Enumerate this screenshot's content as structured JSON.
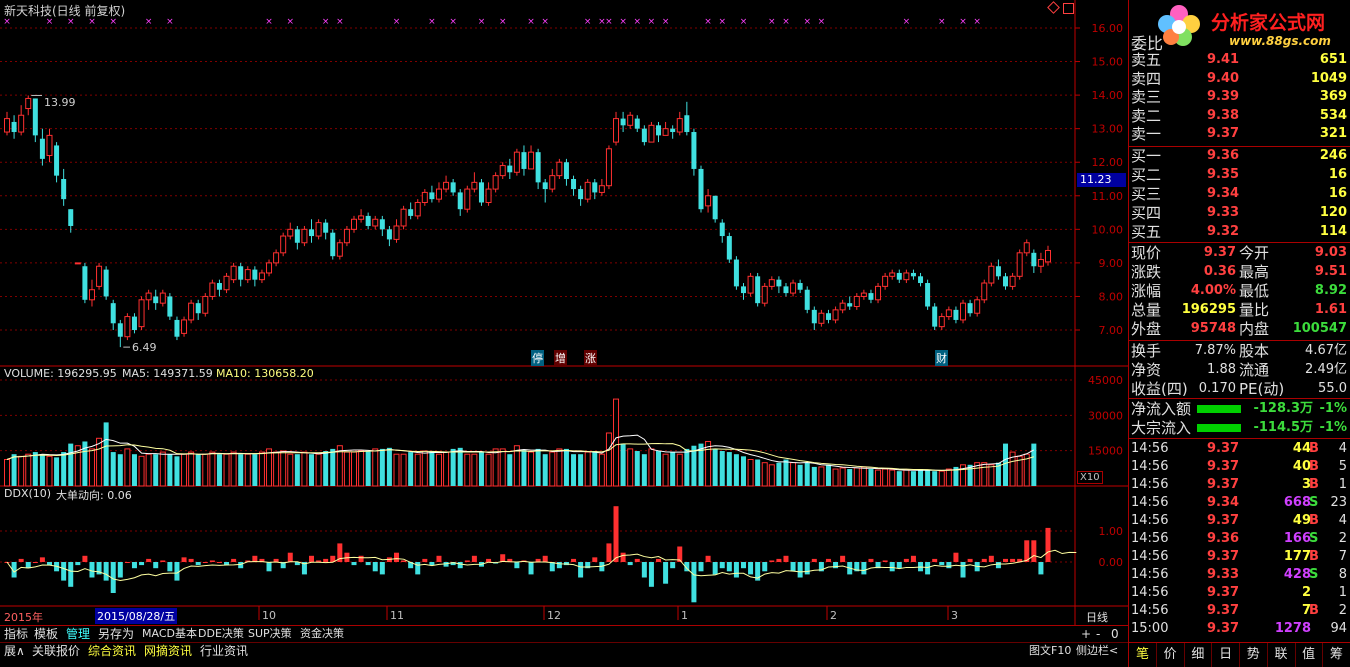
{
  "title": "新天科技(日线 前复权)",
  "price_axis": [
    "16.00",
    "15.00",
    "14.00",
    "13.00",
    "12.00",
    "11.00",
    "10.00",
    "9.00",
    "8.00",
    "7.00"
  ],
  "price_marker": "11.23",
  "high_label": "13.99",
  "low_label": "6.49",
  "event_tags": [
    "停",
    "增",
    "涨",
    "财"
  ],
  "volume_info": {
    "label": "VOLUME: 196295.95",
    "ma5": "MA5: 149371.59",
    "ma10": "MA10: 130658.20"
  },
  "volume_axis": [
    "45000",
    "30000",
    "15000"
  ],
  "volume_unit": "X10",
  "ddx_info": {
    "label": "DDX(10)",
    "big": "大单动向: 0.06"
  },
  "ddx_axis": [
    "1.00",
    "0.00"
  ],
  "date_axis": {
    "year": "2015年",
    "cursor": "2015/08/28/五",
    "m10": "10",
    "m11": "11",
    "m12": "12",
    "m1": "1",
    "m2": "2",
    "m3": "3",
    "period": "日线"
  },
  "bottom_tabs": [
    "指标",
    "模板",
    "管理",
    "另存为",
    "MACD基本",
    "DDE决策",
    "SUP决策",
    "资金决策"
  ],
  "bottom_tabs2": [
    "展∧",
    "关联报价",
    "综合资讯",
    "网摘资讯",
    "行业资讯"
  ],
  "bottom_right": {
    "plus": "+",
    "minus": "-",
    "zero": "0",
    "f10": "图文F10",
    "sidebar": "侧边栏<"
  },
  "logo": {
    "name": "分析家公式网",
    "url": "www.88gs.com"
  },
  "orderbook_header": "委比",
  "asks": [
    {
      "label": "卖五",
      "price": "9.41",
      "vol": "651"
    },
    {
      "label": "卖四",
      "price": "9.40",
      "vol": "1049"
    },
    {
      "label": "卖三",
      "price": "9.39",
      "vol": "369"
    },
    {
      "label": "卖二",
      "price": "9.38",
      "vol": "534"
    },
    {
      "label": "卖一",
      "price": "9.37",
      "vol": "321"
    }
  ],
  "bids": [
    {
      "label": "买一",
      "price": "9.36",
      "vol": "246"
    },
    {
      "label": "买二",
      "price": "9.35",
      "vol": "16"
    },
    {
      "label": "买三",
      "price": "9.34",
      "vol": "16"
    },
    {
      "label": "买四",
      "price": "9.33",
      "vol": "120"
    },
    {
      "label": "买五",
      "price": "9.32",
      "vol": "114"
    }
  ],
  "quote": [
    {
      "l1": "现价",
      "v1": "9.37",
      "l2": "今开",
      "v2": "9.03",
      "c1": "#ff4040",
      "c2": "#ff4040"
    },
    {
      "l1": "涨跌",
      "v1": "0.36",
      "l2": "最高",
      "v2": "9.51",
      "c1": "#ff4040",
      "c2": "#ff4040"
    },
    {
      "l1": "涨幅",
      "v1": "4.00%",
      "l2": "最低",
      "v2": "8.92",
      "c1": "#ff4040",
      "c2": "#3cdc3c"
    },
    {
      "l1": "总量",
      "v1": "196295",
      "l2": "量比",
      "v2": "1.61",
      "c1": "#ffff40",
      "c2": "#ff4040"
    },
    {
      "l1": "外盘",
      "v1": "95748",
      "l2": "内盘",
      "v2": "100547",
      "c1": "#ff4040",
      "c2": "#3cdc3c"
    }
  ],
  "fund": [
    {
      "l1": "换手",
      "v1": "7.87%",
      "l2": "股本",
      "v2": "4.67亿"
    },
    {
      "l1": "净资",
      "v1": "1.88",
      "l2": "流通",
      "v2": "2.49亿"
    },
    {
      "l1": "收益(四)",
      "v1": "0.170",
      "l2": "PE(动)",
      "v2": "55.0"
    }
  ],
  "flows": [
    {
      "label": "净流入额",
      "value": "-128.3万",
      "pct": "-1%"
    },
    {
      "label": "大宗流入",
      "value": "-114.5万",
      "pct": "-1%"
    }
  ],
  "ticks": [
    {
      "t": "14:56",
      "p": "9.37",
      "v": "44",
      "d": "B",
      "n": "4"
    },
    {
      "t": "14:56",
      "p": "9.37",
      "v": "40",
      "d": "B",
      "n": "5"
    },
    {
      "t": "14:56",
      "p": "9.37",
      "v": "3",
      "d": "B",
      "n": "1"
    },
    {
      "t": "14:56",
      "p": "9.34",
      "v": "668",
      "d": "S",
      "n": "23"
    },
    {
      "t": "14:56",
      "p": "9.37",
      "v": "49",
      "d": "B",
      "n": "4"
    },
    {
      "t": "14:56",
      "p": "9.36",
      "v": "166",
      "d": "S",
      "n": "2"
    },
    {
      "t": "14:56",
      "p": "9.37",
      "v": "177",
      "d": "B",
      "n": "7"
    },
    {
      "t": "14:56",
      "p": "9.33",
      "v": "428",
      "d": "S",
      "n": "8"
    },
    {
      "t": "14:56",
      "p": "9.37",
      "v": "2",
      "d": "",
      "n": "1"
    },
    {
      "t": "14:56",
      "p": "9.37",
      "v": "7",
      "d": "B",
      "n": "2"
    },
    {
      "t": "15:00",
      "p": "9.37",
      "v": "1278",
      "d": "",
      "n": "94"
    }
  ],
  "panel_tabs": [
    "笔",
    "价",
    "细",
    "日",
    "势",
    "联",
    "值",
    "筹"
  ],
  "colors": {
    "up": "#ff3030",
    "down": "#40e0e0",
    "grid": "#800000",
    "axis": "#c00000",
    "ma": "#ffffa0",
    "magenta": "#ff40ff",
    "bg": "#000000"
  },
  "chart_data": {
    "type": "candlestick",
    "candles": [
      [
        12.9,
        13.3,
        13.5,
        12.8
      ],
      [
        13.2,
        12.9,
        13.4,
        12.7
      ],
      [
        12.9,
        13.4,
        13.7,
        12.8
      ],
      [
        13.6,
        13.9,
        13.99,
        13.4
      ],
      [
        13.9,
        12.8,
        13.9,
        12.6
      ],
      [
        12.7,
        12.1,
        13.0,
        11.9
      ],
      [
        12.2,
        12.8,
        13.0,
        12.0
      ],
      [
        12.5,
        11.6,
        12.6,
        11.4
      ],
      [
        11.5,
        10.9,
        11.8,
        10.7
      ],
      [
        10.6,
        10.1,
        10.6,
        9.9
      ],
      [
        9.0,
        9.0,
        9.0,
        9.0
      ],
      [
        8.9,
        7.9,
        9.0,
        7.8
      ],
      [
        7.9,
        8.2,
        8.5,
        7.7
      ],
      [
        8.3,
        8.9,
        9.0,
        8.2
      ],
      [
        8.8,
        8.0,
        8.9,
        7.9
      ],
      [
        7.8,
        7.2,
        7.9,
        7.0
      ],
      [
        7.2,
        6.8,
        7.3,
        6.49
      ],
      [
        6.8,
        7.4,
        7.5,
        6.7
      ],
      [
        7.4,
        7.0,
        7.5,
        6.9
      ],
      [
        7.1,
        7.9,
        8.0,
        7.0
      ],
      [
        7.9,
        8.1,
        8.2,
        7.6
      ],
      [
        8.0,
        7.8,
        8.2,
        7.6
      ],
      [
        7.8,
        8.1,
        8.2,
        7.7
      ],
      [
        8.0,
        7.4,
        8.1,
        7.3
      ],
      [
        7.3,
        6.8,
        7.4,
        6.7
      ],
      [
        6.9,
        7.3,
        7.4,
        6.8
      ],
      [
        7.3,
        7.8,
        7.9,
        7.2
      ],
      [
        7.8,
        7.5,
        7.9,
        7.3
      ],
      [
        7.5,
        8.0,
        8.1,
        7.4
      ],
      [
        8.0,
        8.4,
        8.5,
        7.9
      ],
      [
        8.4,
        8.2,
        8.5,
        8.0
      ],
      [
        8.2,
        8.6,
        8.7,
        8.1
      ],
      [
        8.5,
        8.9,
        9.0,
        8.4
      ],
      [
        8.9,
        8.5,
        9.0,
        8.3
      ],
      [
        8.5,
        8.8,
        8.9,
        8.4
      ],
      [
        8.8,
        8.5,
        8.9,
        8.3
      ],
      [
        8.5,
        8.7,
        8.8,
        8.4
      ],
      [
        8.7,
        9.0,
        9.1,
        8.6
      ],
      [
        9.0,
        9.3,
        9.4,
        8.9
      ],
      [
        9.3,
        9.8,
        9.9,
        9.2
      ],
      [
        9.8,
        10.0,
        10.2,
        9.7
      ],
      [
        10.0,
        9.6,
        10.1,
        9.4
      ],
      [
        9.6,
        10.0,
        10.1,
        9.5
      ],
      [
        10.0,
        9.8,
        10.3,
        9.6
      ],
      [
        9.8,
        10.2,
        10.3,
        9.7
      ],
      [
        10.2,
        9.9,
        10.3,
        9.7
      ],
      [
        9.9,
        9.2,
        10.0,
        9.1
      ],
      [
        9.2,
        9.6,
        9.7,
        9.1
      ],
      [
        9.6,
        10.0,
        10.1,
        9.5
      ],
      [
        10.0,
        10.3,
        10.4,
        9.9
      ],
      [
        10.3,
        10.4,
        10.6,
        10.2
      ],
      [
        10.4,
        10.1,
        10.5,
        10.0
      ],
      [
        10.1,
        10.3,
        10.4,
        10.0
      ],
      [
        10.3,
        10.0,
        10.4,
        9.8
      ],
      [
        10.0,
        9.7,
        10.1,
        9.5
      ],
      [
        9.7,
        10.1,
        10.3,
        9.6
      ],
      [
        10.1,
        10.6,
        10.7,
        10.0
      ],
      [
        10.6,
        10.4,
        10.8,
        10.3
      ],
      [
        10.4,
        10.8,
        10.9,
        10.3
      ],
      [
        10.8,
        11.1,
        11.2,
        10.7
      ],
      [
        11.1,
        10.9,
        11.3,
        10.8
      ],
      [
        10.9,
        11.2,
        11.4,
        10.8
      ],
      [
        11.2,
        11.4,
        11.6,
        11.1
      ],
      [
        11.4,
        11.1,
        11.5,
        11.0
      ],
      [
        11.1,
        10.6,
        11.2,
        10.4
      ],
      [
        10.6,
        11.2,
        11.3,
        10.5
      ],
      [
        11.2,
        11.4,
        11.7,
        11.1
      ],
      [
        11.4,
        10.8,
        11.5,
        10.7
      ],
      [
        10.8,
        11.2,
        11.4,
        10.7
      ],
      [
        11.2,
        11.6,
        11.7,
        11.1
      ],
      [
        11.6,
        11.9,
        12.0,
        11.5
      ],
      [
        11.9,
        11.7,
        12.1,
        11.5
      ],
      [
        11.7,
        12.3,
        12.4,
        11.6
      ],
      [
        12.3,
        11.8,
        12.5,
        11.6
      ],
      [
        11.8,
        12.3,
        12.5,
        11.8
      ],
      [
        12.3,
        11.4,
        12.4,
        11.2
      ],
      [
        11.4,
        11.2,
        11.5,
        10.8
      ],
      [
        11.2,
        11.6,
        11.8,
        11.1
      ],
      [
        11.6,
        12.0,
        12.1,
        11.5
      ],
      [
        12.0,
        11.5,
        12.1,
        11.3
      ],
      [
        11.5,
        11.2,
        11.6,
        11.0
      ],
      [
        11.2,
        10.9,
        11.3,
        10.7
      ],
      [
        10.9,
        11.4,
        11.5,
        10.8
      ],
      [
        11.4,
        11.1,
        11.5,
        10.9
      ],
      [
        11.1,
        11.3,
        11.5,
        11.0
      ],
      [
        11.3,
        12.4,
        12.5,
        11.2
      ],
      [
        12.6,
        13.3,
        13.5,
        12.5
      ],
      [
        13.3,
        13.1,
        13.5,
        12.9
      ],
      [
        13.1,
        13.4,
        13.5,
        13.0
      ],
      [
        13.3,
        13.0,
        13.4,
        12.9
      ],
      [
        13.0,
        12.6,
        13.1,
        12.5
      ],
      [
        12.6,
        13.1,
        13.2,
        12.6
      ],
      [
        13.1,
        12.8,
        13.2,
        12.6
      ],
      [
        12.8,
        13.0,
        13.2,
        12.8
      ],
      [
        13.0,
        12.9,
        13.1,
        12.7
      ],
      [
        12.9,
        13.3,
        13.5,
        12.8
      ],
      [
        13.4,
        12.9,
        13.8,
        12.8
      ],
      [
        12.9,
        11.8,
        13.0,
        11.6
      ],
      [
        11.8,
        10.6,
        11.9,
        10.5
      ],
      [
        10.7,
        11.0,
        11.2,
        10.5
      ],
      [
        11.0,
        10.3,
        11.0,
        10.2
      ],
      [
        10.2,
        9.8,
        10.3,
        9.6
      ],
      [
        9.8,
        9.1,
        9.9,
        9.0
      ],
      [
        9.1,
        8.3,
        9.2,
        8.2
      ],
      [
        8.3,
        8.1,
        8.4,
        7.9
      ],
      [
        8.1,
        8.6,
        8.7,
        8.0
      ],
      [
        8.6,
        7.8,
        8.7,
        7.7
      ],
      [
        7.8,
        8.3,
        8.4,
        7.7
      ],
      [
        8.3,
        8.5,
        8.6,
        8.2
      ],
      [
        8.5,
        8.3,
        8.6,
        8.1
      ],
      [
        8.3,
        8.1,
        8.4,
        8.0
      ],
      [
        8.1,
        8.4,
        8.5,
        8.0
      ],
      [
        8.4,
        8.2,
        8.5,
        8.1
      ],
      [
        8.2,
        7.6,
        8.3,
        7.5
      ],
      [
        7.6,
        7.2,
        7.7,
        7.0
      ],
      [
        7.2,
        7.5,
        7.6,
        7.1
      ],
      [
        7.5,
        7.3,
        7.6,
        7.2
      ],
      [
        7.3,
        7.6,
        7.7,
        7.2
      ],
      [
        7.6,
        7.8,
        7.9,
        7.5
      ],
      [
        7.8,
        7.7,
        8.0,
        7.6
      ],
      [
        7.7,
        8.0,
        8.1,
        7.6
      ],
      [
        8.0,
        8.1,
        8.2,
        7.9
      ],
      [
        8.1,
        7.9,
        8.2,
        7.8
      ],
      [
        7.9,
        8.3,
        8.4,
        7.8
      ],
      [
        8.3,
        8.6,
        8.7,
        8.2
      ],
      [
        8.6,
        8.7,
        8.8,
        8.5
      ],
      [
        8.7,
        8.5,
        8.8,
        8.4
      ],
      [
        8.5,
        8.7,
        8.8,
        8.4
      ],
      [
        8.7,
        8.6,
        8.8,
        8.5
      ],
      [
        8.6,
        8.4,
        8.7,
        8.3
      ],
      [
        8.4,
        7.7,
        8.5,
        7.6
      ],
      [
        7.7,
        7.1,
        7.8,
        7.0
      ],
      [
        7.1,
        7.4,
        7.5,
        7.0
      ],
      [
        7.4,
        7.6,
        7.7,
        7.3
      ],
      [
        7.6,
        7.3,
        7.7,
        7.2
      ],
      [
        7.3,
        7.8,
        7.9,
        7.2
      ],
      [
        7.8,
        7.5,
        7.9,
        7.4
      ],
      [
        7.5,
        7.9,
        8.0,
        7.4
      ],
      [
        7.9,
        8.4,
        8.5,
        7.8
      ],
      [
        8.4,
        8.9,
        9.0,
        8.3
      ],
      [
        8.9,
        8.6,
        9.1,
        8.5
      ],
      [
        8.6,
        8.3,
        8.7,
        8.2
      ],
      [
        8.3,
        8.6,
        8.7,
        8.2
      ],
      [
        8.6,
        9.3,
        9.4,
        8.5
      ],
      [
        9.3,
        9.6,
        9.7,
        9.2
      ],
      [
        9.3,
        8.9,
        9.4,
        8.7
      ],
      [
        8.9,
        9.1,
        9.3,
        8.7
      ],
      [
        9.03,
        9.37,
        9.51,
        8.92
      ]
    ],
    "volume_ratio": [
      0.25,
      0.3,
      0.28,
      0.3,
      0.32,
      0.3,
      0.28,
      0.27,
      0.32,
      0.4,
      0.38,
      0.42,
      0.35,
      0.45,
      0.6,
      0.32,
      0.3,
      0.35,
      0.3,
      0.28,
      0.3,
      0.3,
      0.32,
      0.3,
      0.28,
      0.3,
      0.32,
      0.3,
      0.3,
      0.32,
      0.3,
      0.3,
      0.32,
      0.3,
      0.3,
      0.3,
      0.32,
      0.35,
      0.32,
      0.33,
      0.3,
      0.3,
      0.32,
      0.3,
      0.3,
      0.33,
      0.35,
      0.38,
      0.32,
      0.32,
      0.33,
      0.33,
      0.35,
      0.35,
      0.36,
      0.3,
      0.3,
      0.32,
      0.3,
      0.33,
      0.33,
      0.3,
      0.32,
      0.35,
      0.36,
      0.3,
      0.3,
      0.32,
      0.3,
      0.35,
      0.35,
      0.3,
      0.38,
      0.34,
      0.32,
      0.35,
      0.3,
      0.32,
      0.35,
      0.35,
      0.3,
      0.3,
      0.32,
      0.33,
      0.3,
      0.5,
      0.82,
      0.4,
      0.35,
      0.33,
      0.3,
      0.35,
      0.33,
      0.3,
      0.32,
      0.3,
      0.35,
      0.38,
      0.4,
      0.42,
      0.35,
      0.33,
      0.32,
      0.3,
      0.28,
      0.25,
      0.25,
      0.22,
      0.2,
      0.22,
      0.25,
      0.22,
      0.2,
      0.22,
      0.18,
      0.18,
      0.2,
      0.16,
      0.17,
      0.16,
      0.17,
      0.18,
      0.16,
      0.15,
      0.16,
      0.15,
      0.14,
      0.15,
      0.14,
      0.16,
      0.15,
      0.14,
      0.14,
      0.16,
      0.18,
      0.2,
      0.2,
      0.22,
      0.22,
      0.2,
      0.22,
      0.4,
      0.32,
      0.28,
      0.3,
      0.4
    ],
    "ddx": [
      0.0,
      -0.5,
      0.1,
      -0.2,
      0.0,
      0.15,
      -0.1,
      -0.3,
      -0.6,
      -0.8,
      -0.1,
      0.2,
      -0.5,
      -0.4,
      -0.6,
      -1.0,
      -0.5,
      0.0,
      -0.2,
      -0.1,
      0.1,
      -0.2,
      0.05,
      -0.3,
      -0.6,
      0.15,
      0.1,
      -0.1,
      0.0,
      0.05,
      0.0,
      -0.1,
      0.1,
      -0.2,
      0.05,
      0.2,
      0.1,
      -0.3,
      0.1,
      -0.2,
      0.3,
      -0.1,
      -0.4,
      0.2,
      0.05,
      0.1,
      0.2,
      0.6,
      0.3,
      -0.1,
      0.2,
      -0.1,
      -0.3,
      -0.4,
      0.15,
      0.3,
      0.05,
      -0.2,
      -0.4,
      0.1,
      -0.1,
      0.2,
      -0.15,
      -0.1,
      -0.2,
      0.05,
      0.2,
      -0.15,
      0.1,
      -0.05,
      0.25,
      0.1,
      -0.2,
      0.05,
      -0.4,
      0.1,
      0.2,
      -0.3,
      -0.2,
      -0.1,
      0.1,
      -0.5,
      -0.2,
      0.15,
      -0.3,
      0.6,
      1.8,
      0.3,
      -0.1,
      0.1,
      -0.5,
      -0.8,
      0.1,
      -0.7,
      -0.2,
      0.5,
      -0.3,
      -1.3,
      -0.3,
      0.2,
      -0.4,
      -0.2,
      -0.3,
      -0.5,
      -0.2,
      -0.4,
      -0.6,
      -0.3,
      0.05,
      0.1,
      0.2,
      -0.3,
      -0.5,
      -0.4,
      0.1,
      -0.3,
      0.1,
      -0.2,
      0.2,
      -0.4,
      -0.3,
      -0.4,
      0.1,
      -0.2,
      0.05,
      -0.3,
      -0.2,
      0.1,
      0.2,
      -0.3,
      -0.4,
      0.1,
      -0.1,
      -0.2,
      0.3,
      -0.5,
      0.1,
      -0.3,
      0.1,
      0.2,
      -0.2,
      0.1,
      0.1,
      0.1,
      0.7,
      0.7,
      -0.4,
      1.1,
      0.5,
      -0.6,
      0.1,
      0.05
    ]
  }
}
